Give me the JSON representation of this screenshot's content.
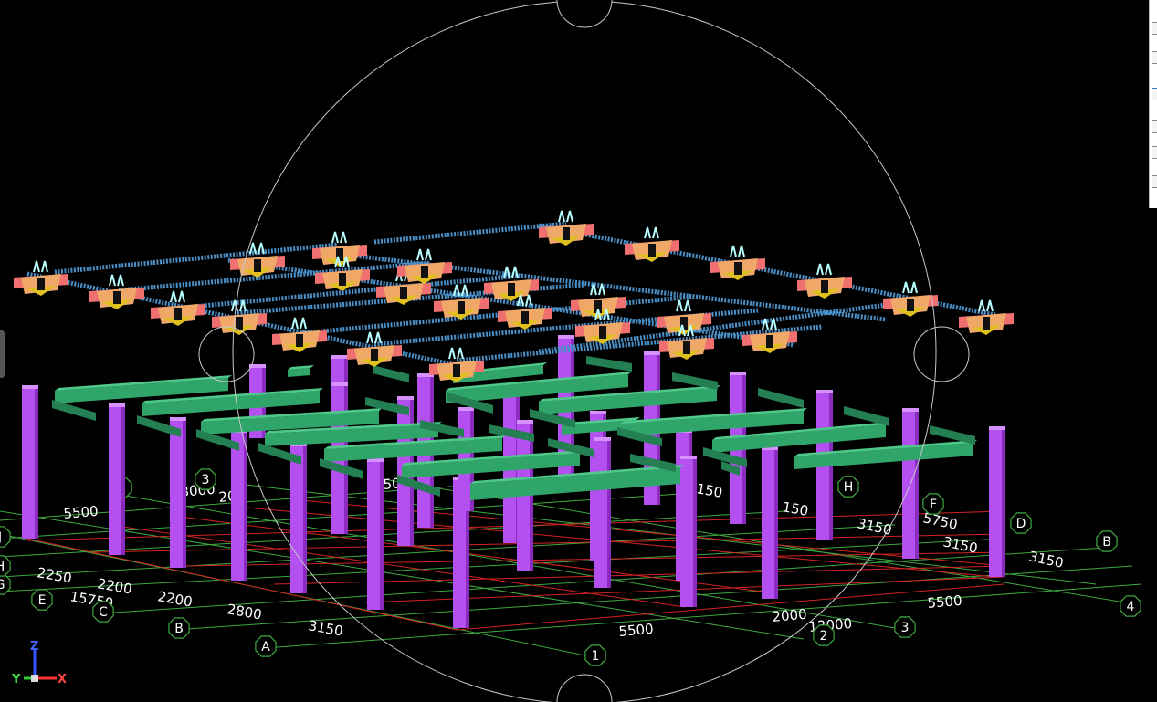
{
  "viewport": {
    "background": "#000000",
    "grid_bubbles_lower": [
      "A",
      "B",
      "C",
      "E",
      "G",
      "H",
      "J"
    ],
    "grid_bubbles_right": [
      "1",
      "2",
      "3",
      "4",
      "B",
      "D",
      "F",
      "H"
    ],
    "grid_bubbles_top": [
      "2",
      "3"
    ],
    "dimension_labels": {
      "d5500a": "5500",
      "d3000": "3000",
      "d2250": "2250",
      "d2200a": "2200",
      "d15750": "15750",
      "d2200b": "2200",
      "d2800": "2800",
      "d3150a": "3150",
      "d5500b": "5500",
      "d2000": "2000",
      "d13000": "13000",
      "d5500c": "5500",
      "d3150b": "3150",
      "d3150c": "3150",
      "d3150d": "3150",
      "d5750": "5750",
      "d150a": "150",
      "d150b": "150",
      "d3150e": "3150",
      "d20": "20",
      "d50": "50"
    },
    "colors": {
      "column": "#b450f0",
      "beam": "#2fa56a",
      "grid_green": "#3fa83f",
      "grid_red": "#d42222",
      "bearing": "#f0a868",
      "steel_beam": "#4a90c8",
      "orbit": "#c8c8c8"
    }
  },
  "axis_triad": {
    "x_label": "X",
    "y_label": "Y",
    "z_label": "Z"
  },
  "side_panel": {
    "icons": [
      "panel-tool-icon-1",
      "panel-tool-icon-2",
      "panel-tool-icon-3",
      "panel-tool-icon-4",
      "panel-tool-icon-5",
      "panel-tool-icon-6",
      "panel-tool-icon-7"
    ]
  }
}
